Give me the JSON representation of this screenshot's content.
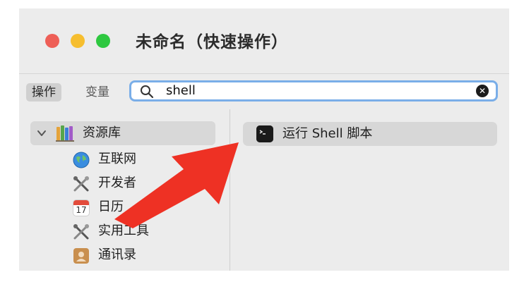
{
  "window": {
    "title": "未命名（快速操作）"
  },
  "toolbar": {
    "actions_label": "操作",
    "variables_label": "变量",
    "search": {
      "value": "shell",
      "placeholder": ""
    }
  },
  "sidebar": {
    "library": {
      "label": "资源库",
      "icon": "library-icon"
    },
    "items": [
      {
        "label": "互联网",
        "icon": "globe-icon"
      },
      {
        "label": "开发者",
        "icon": "tools-icon"
      },
      {
        "label": "日历",
        "icon": "calendar-icon",
        "calendar_day": "17",
        "calendar_month": "JUL"
      },
      {
        "label": "实用工具",
        "icon": "tools-icon"
      },
      {
        "label": "通讯录",
        "icon": "contacts-icon"
      }
    ]
  },
  "content": {
    "actions": [
      {
        "label": "运行 Shell 脚本",
        "icon": "terminal-icon"
      }
    ]
  },
  "annotation": {
    "icon": "red-arrow-icon",
    "color": "#ee3124"
  },
  "colors": {
    "close": "#ee5f57",
    "minimize": "#f6be2f",
    "zoom": "#2ec840",
    "search_focus": "#7aaee8",
    "selection": "#d8d8d8"
  }
}
